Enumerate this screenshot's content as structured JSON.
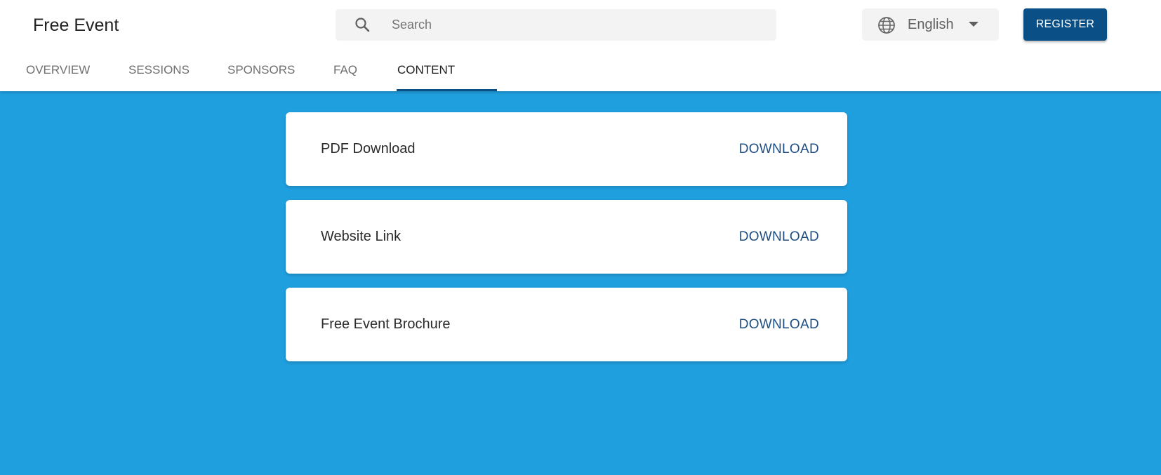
{
  "header": {
    "event_title": "Free Event",
    "search": {
      "placeholder": "Search",
      "value": ""
    },
    "language": {
      "selected": "English"
    },
    "register_label": "REGISTER"
  },
  "tabs": [
    {
      "label": "OVERVIEW"
    },
    {
      "label": "SESSIONS"
    },
    {
      "label": "SPONSORS"
    },
    {
      "label": "FAQ"
    },
    {
      "label": "CONTENT",
      "active": true
    }
  ],
  "content_items": [
    {
      "title": "PDF Download",
      "action_label": "DOWNLOAD"
    },
    {
      "title": "Website Link",
      "action_label": "DOWNLOAD"
    },
    {
      "title": "Free Event Brochure",
      "action_label": "DOWNLOAD"
    }
  ],
  "colors": {
    "background": "#209fdf",
    "primary": "#0a4f86",
    "link": "#1d4d82"
  },
  "icons": {
    "search": "search-icon",
    "language": "globe-icon",
    "dropdown": "chevron-down-icon"
  }
}
